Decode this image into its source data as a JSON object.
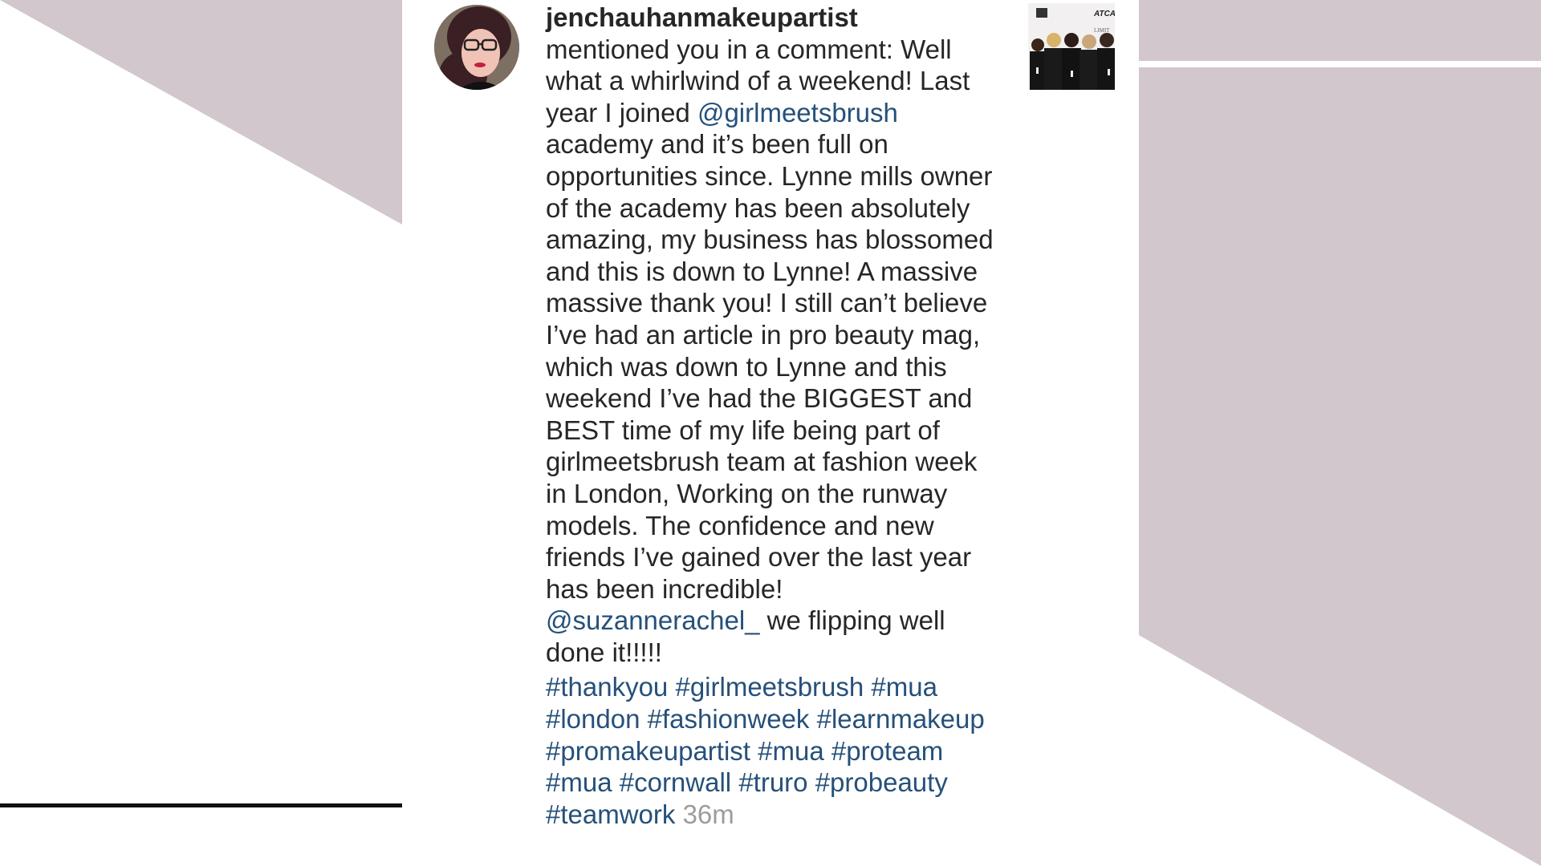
{
  "notification": {
    "username": "jenchauhanmakeupartist",
    "comment_parts": [
      {
        "type": "text",
        "text": "mentioned you in a comment: Well what a whirlwind of a weekend! Last year I joined "
      },
      {
        "type": "mention",
        "text": "@girlmeetsbrush"
      },
      {
        "type": "text",
        "text": " academy and it’s been full on opportunities since.  Lynne mills owner of the academy has been absolutely amazing, my business has blossomed and this is down to Lynne! A massive massive thank you! I still can’t believe I’ve had an article in pro beauty mag, which was down to Lynne and this weekend I’ve had the BIGGEST and BEST time of my life being part of girlmeetsbrush team at fashion week in London, Working on the runway models.  The confidence and new friends I’ve gained over the last year has been incredible! "
      },
      {
        "type": "mention",
        "text": "@suzannerachel_"
      },
      {
        "type": "text",
        "text": "  we flipping well done it!!!!!"
      }
    ],
    "hashtags": [
      "#thankyou",
      "#girlmeetsbrush",
      "#mua",
      "#london",
      "#fashionweek",
      "#learnmakeup",
      "#promakeupartist",
      "#mua",
      "#proteam",
      "#mua",
      "#cornwall",
      "#truro",
      "#probeauty",
      "#teamwork"
    ],
    "time": "36m",
    "thumbnail_text": "ATCA",
    "thumbnail_small_text": "LIMIT"
  },
  "colors": {
    "background": "#ffffff",
    "decor_mauve": "#d2c7cd",
    "text": "#262626",
    "link": "#26507a",
    "muted": "#9c9c9c",
    "rule": "#111111"
  }
}
